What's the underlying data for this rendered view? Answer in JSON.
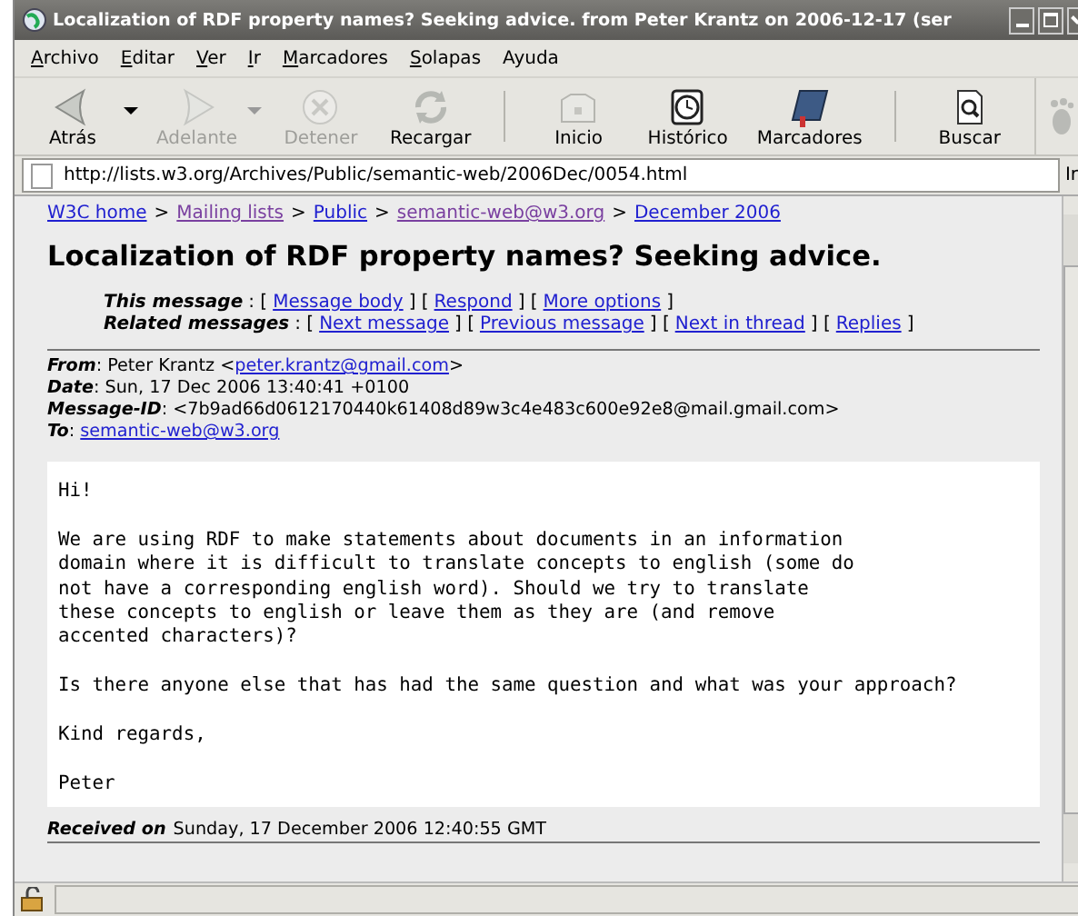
{
  "window": {
    "title": "Localization of RDF property names? Seeking advice. from Peter Krantz on 2006-12-17 (ser"
  },
  "menu": [
    {
      "label": "Archivo",
      "mnemonic_first": true
    },
    {
      "label": "Editar",
      "mnemonic_first": true
    },
    {
      "label": "Ver",
      "mnemonic_first": true
    },
    {
      "label": "Ir",
      "mnemonic_first": true
    },
    {
      "label": "Marcadores",
      "mnemonic_first": true
    },
    {
      "label": "Solapas",
      "mnemonic_first": true
    },
    {
      "label": "Ayuda",
      "mnemonic_first": false
    }
  ],
  "toolbar": [
    {
      "kind": "back",
      "label": "Atrás",
      "disabled": false,
      "dropdown": true
    },
    {
      "kind": "forward",
      "label": "Adelante",
      "disabled": true,
      "dropdown": true
    },
    {
      "kind": "stop",
      "label": "Detener",
      "disabled": true,
      "dropdown": false
    },
    {
      "kind": "reload",
      "label": "Recargar",
      "disabled": false,
      "dropdown": false
    },
    {
      "kind": "separator"
    },
    {
      "kind": "home",
      "label": "Inicio",
      "disabled": false,
      "dropdown": false
    },
    {
      "kind": "history",
      "label": "Histórico",
      "disabled": false,
      "dropdown": false
    },
    {
      "kind": "bookmarks",
      "label": "Marcadores",
      "disabled": false,
      "dropdown": false
    },
    {
      "kind": "separator"
    },
    {
      "kind": "search",
      "label": "Buscar",
      "disabled": false,
      "dropdown": false
    }
  ],
  "address_bar": {
    "url": "http://lists.w3.org/Archives/Public/semantic-web/2006Dec/0054.html",
    "go_button": "Ir"
  },
  "page": {
    "breadcrumbs": [
      {
        "label": "W3C home",
        "visited": false
      },
      {
        "label": "Mailing lists",
        "visited": true
      },
      {
        "label": "Public",
        "visited": false
      },
      {
        "label": "semantic-web@w3.org",
        "visited": true
      },
      {
        "label": "December 2006",
        "visited": false
      }
    ],
    "separator": ">",
    "heading": "Localization of RDF property names? Seeking advice.",
    "nav": [
      {
        "label": "This message",
        "open": ": [",
        "links": [
          "Message body",
          "Respond",
          "More options"
        ],
        "between": [
          "] [",
          "] ["
        ],
        "close": "]"
      },
      {
        "label": "Related messages",
        "open": ": [",
        "links": [
          "Next message",
          "Previous message",
          "Next in thread",
          "Replies"
        ],
        "between": [
          "] [",
          "] [",
          "] ["
        ],
        "close": "]"
      }
    ],
    "headers": [
      {
        "name": "From",
        "colon": ":",
        "text": "Peter Krantz <",
        "link": "peter.krantz@gmail.com",
        "after": ">"
      },
      {
        "name": "Date",
        "colon": ":",
        "text": "Sun, 17 Dec 2006 13:40:41 +0100"
      },
      {
        "name": "Message-ID",
        "colon": ":",
        "text": "<7b9ad66d0612170440k61408d89w3c4e483c600e92e8@mail.gmail.com>"
      },
      {
        "name": "To",
        "colon": ":",
        "link": "semantic-web@w3.org"
      }
    ],
    "body": [
      "Hi!",
      "We are using RDF to make statements about documents in an information\ndomain where it is difficult to translate concepts to english (some do\nnot have a corresponding english word). Should we try to translate\nthese concepts to english or leave them as they are (and remove\naccented characters)?",
      "Is there anyone else that has had the same question and what was your approach?",
      "Kind regards,",
      "Peter"
    ],
    "received": {
      "label": "Received on",
      "text": "Sunday, 17 December 2006 12:40:55 GMT"
    }
  }
}
